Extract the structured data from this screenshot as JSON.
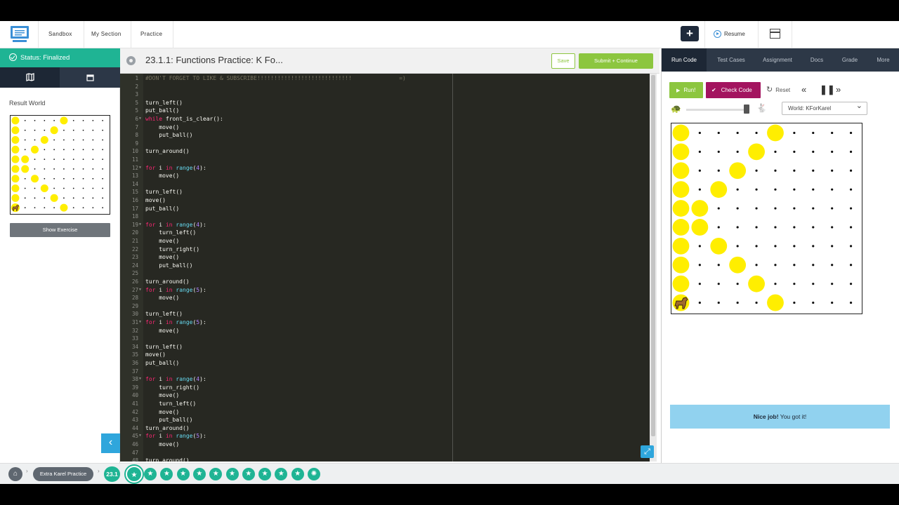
{
  "nav": {
    "links": [
      "Sandbox",
      "My Section",
      "Practice"
    ],
    "plus_label": "+",
    "resume_label": "Resume"
  },
  "left": {
    "status": "Status: Finalized",
    "result_world_label": "Result World",
    "show_exercise_label": "Show Exercise",
    "collapse_label": "‹"
  },
  "editor": {
    "title": "23.1.1: Functions Practice: K Fo...",
    "save_label": "Save",
    "submit_label": "Submit + Continue",
    "comment_text": "#DON'T FORGET TO LIKE & SUBSCRIBE!!!!!!!!!!!!!!!!!!!!!!!!!!!!",
    "comment_tail": "=)",
    "code": [
      {
        "n": "1",
        "t": "#DON'T FORGET TO LIKE & SUBSCRIBE!!!!!!!!!!!!!!!!!!!!!!!!!!!!              =)"
      },
      {
        "n": "2",
        "t": ""
      },
      {
        "n": "3",
        "t": ""
      },
      {
        "n": "5",
        "t": "turn_left()"
      },
      {
        "n": "5",
        "t": "put_ball()"
      },
      {
        "n": "6",
        "t": "while front_is_clear():"
      },
      {
        "n": "7",
        "t": "    move()"
      },
      {
        "n": "8",
        "t": "    put_ball()"
      },
      {
        "n": "9",
        "t": ""
      },
      {
        "n": "10",
        "t": "turn_around()"
      },
      {
        "n": "11",
        "t": ""
      },
      {
        "n": "12",
        "t": "for i in range(4):"
      },
      {
        "n": "13",
        "t": "    move()"
      },
      {
        "n": "14",
        "t": ""
      },
      {
        "n": "15",
        "t": "turn_left()"
      },
      {
        "n": "16",
        "t": "move()"
      },
      {
        "n": "17",
        "t": "put_ball()"
      },
      {
        "n": "18",
        "t": ""
      },
      {
        "n": "19",
        "t": "for i in range(4):"
      },
      {
        "n": "20",
        "t": "    turn_left()"
      },
      {
        "n": "21",
        "t": "    move()"
      },
      {
        "n": "22",
        "t": "    turn_right()"
      },
      {
        "n": "23",
        "t": "    move()"
      },
      {
        "n": "24",
        "t": "    put_ball()"
      },
      {
        "n": "25",
        "t": ""
      },
      {
        "n": "26",
        "t": "turn_around()"
      },
      {
        "n": "27",
        "t": "for i in range(5):"
      },
      {
        "n": "28",
        "t": "    move()"
      },
      {
        "n": "29",
        "t": ""
      },
      {
        "n": "30",
        "t": "turn_left()"
      },
      {
        "n": "31",
        "t": "for i in range(5):"
      },
      {
        "n": "32",
        "t": "    move()"
      },
      {
        "n": "33",
        "t": ""
      },
      {
        "n": "34",
        "t": "turn_left()"
      },
      {
        "n": "35",
        "t": "move()"
      },
      {
        "n": "36",
        "t": "put_ball()"
      },
      {
        "n": "37",
        "t": ""
      },
      {
        "n": "38",
        "t": "for i in range(4):"
      },
      {
        "n": "39",
        "t": "    turn_right()"
      },
      {
        "n": "40",
        "t": "    move()"
      },
      {
        "n": "41",
        "t": "    turn_left()"
      },
      {
        "n": "42",
        "t": "    move()"
      },
      {
        "n": "43",
        "t": "    put_ball()"
      },
      {
        "n": "44",
        "t": "turn_around()"
      },
      {
        "n": "45",
        "t": "for i in range(5):"
      },
      {
        "n": "46",
        "t": "    move()"
      },
      {
        "n": "47",
        "t": ""
      },
      {
        "n": "48",
        "t": "turn_around()"
      }
    ]
  },
  "right": {
    "tabs": [
      "Run Code",
      "Test Cases",
      "Assignment",
      "Docs",
      "Grade",
      "More"
    ],
    "run_label": "Run!",
    "check_label": "Check Code",
    "reset_label": "Reset",
    "world_select": "World: KForKarel",
    "nice_bold": "Nice job!",
    "nice_text": " You got it!"
  },
  "world": {
    "rows": 10,
    "cols": 10,
    "balls": [
      [
        0,
        0
      ],
      [
        0,
        5
      ],
      [
        1,
        0
      ],
      [
        1,
        4
      ],
      [
        2,
        0
      ],
      [
        2,
        3
      ],
      [
        3,
        0
      ],
      [
        3,
        2
      ],
      [
        4,
        0
      ],
      [
        4,
        1
      ],
      [
        5,
        0
      ],
      [
        5,
        1
      ],
      [
        6,
        0
      ],
      [
        6,
        2
      ],
      [
        7,
        0
      ],
      [
        7,
        3
      ],
      [
        8,
        0
      ],
      [
        8,
        4
      ],
      [
        9,
        5
      ]
    ],
    "karel": [
      9,
      0
    ],
    "ball_color": "#ffee00",
    "karel_icon": "dog-icon"
  },
  "bottom": {
    "crumb": "Extra Karel Practice",
    "lesson": "23.1",
    "star_count": 12
  }
}
